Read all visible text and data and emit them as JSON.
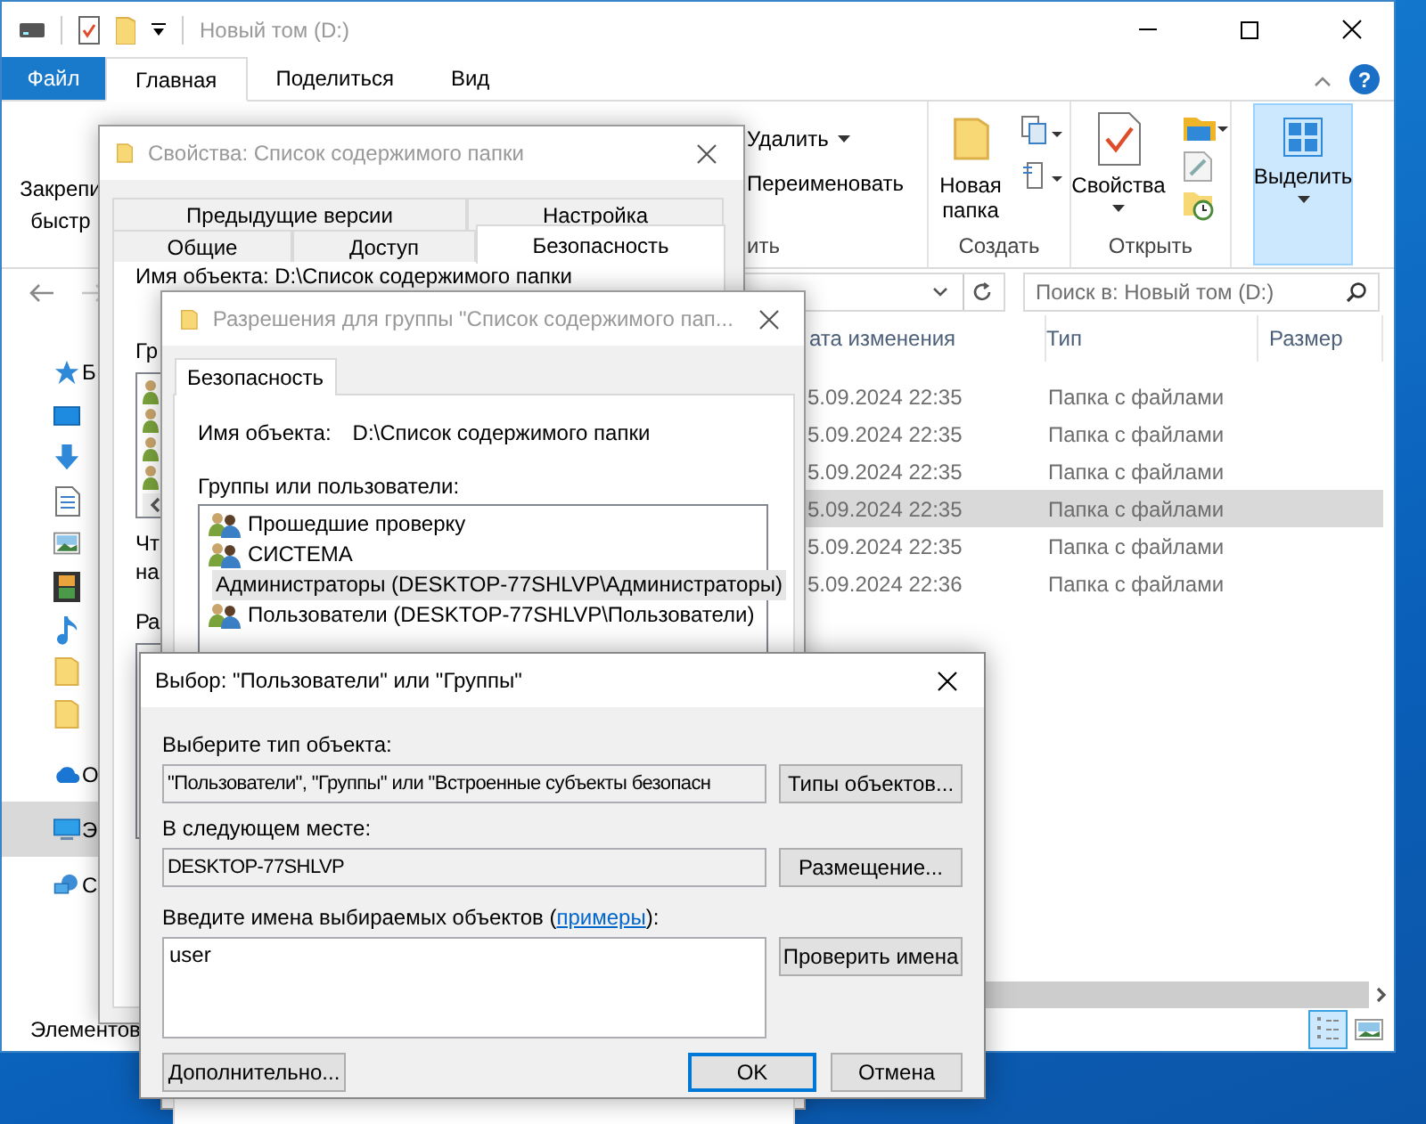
{
  "explorer": {
    "title": "Новый том (D:)",
    "ribbon_tabs": [
      {
        "label": "Файл",
        "kind": "menu",
        "selected": false
      },
      {
        "label": "Главная",
        "kind": "tab",
        "selected": true
      },
      {
        "label": "Поделиться",
        "kind": "tab",
        "selected": false
      },
      {
        "label": "Вид",
        "kind": "tab",
        "selected": false
      }
    ],
    "help": "?",
    "ribbon": {
      "pin_lines": [
        "Закрепи",
        "быстр"
      ],
      "delete": "Удалить",
      "rename": "Переименовать",
      "organize_group": "ить",
      "new_folder": "Новая папка",
      "create_group": "Создать",
      "properties": "Свойства",
      "open_group": "Открыть",
      "select": {
        "label": "Выделить",
        "highlighted": true
      }
    },
    "search": {
      "placeholder": "Поиск в: Новый том (D:)"
    },
    "nav_quick": [
      {
        "label": "Б",
        "selected": false
      },
      {
        "selected": false
      },
      {
        "selected": false
      },
      {
        "selected": false
      },
      {
        "selected": false
      },
      {
        "selected": false
      },
      {
        "selected": false
      },
      {
        "selected": false
      },
      {
        "selected": false
      }
    ],
    "nav_other": [
      {
        "label": "О",
        "selected": false
      },
      {
        "label": "Э",
        "selected": true
      },
      {
        "label": "С",
        "selected": false
      }
    ],
    "columns": [
      "ата изменения",
      "Тип",
      "Размер"
    ],
    "rows": [
      {
        "date": "5.09.2024 22:35",
        "type": "Папка с файлами",
        "selected": false
      },
      {
        "date": "5.09.2024 22:35",
        "type": "Папка с файлами",
        "selected": false
      },
      {
        "date": "5.09.2024 22:35",
        "type": "Папка с файлами",
        "selected": false
      },
      {
        "date": "5.09.2024 22:35",
        "type": "Папка с файлами",
        "selected": true
      },
      {
        "date": "5.09.2024 22:35",
        "type": "Папка с файлами",
        "selected": false
      },
      {
        "date": "5.09.2024 22:36",
        "type": "Папка с файлами",
        "selected": false
      }
    ],
    "status_bar": "Элементов"
  },
  "properties_dialog": {
    "title": "Свойства: Список содержимого папки",
    "tab_rows": [
      [
        {
          "label": "Предыдущие версии",
          "selected": false
        },
        {
          "label": "Настройка",
          "selected": false
        }
      ],
      [
        {
          "label": "Общие",
          "selected": false
        },
        {
          "label": "Доступ",
          "selected": false
        },
        {
          "label": "Безопасность",
          "selected": true
        }
      ]
    ],
    "object_name": "Имя объекта:   D:\\Список содержимого папки",
    "groups_label": "Гр",
    "note_lines": [
      "Чт",
      "на"
    ],
    "permissions_label": "Ра"
  },
  "permissions_dialog": {
    "title": "Разрешения для группы \"Список содержимого пап...",
    "tabs": [
      {
        "label": "Безопасность",
        "selected": true
      }
    ],
    "object_name_label": "Имя объекта:",
    "object_name": "D:\\Список содержимого папки",
    "groups_label": "Группы или пользователи:",
    "principals": [
      {
        "name": "Прошедшие проверку",
        "selected": false
      },
      {
        "name": "СИСТЕМА",
        "selected": false
      },
      {
        "name": "Администраторы (DESKTOP-77SHLVP\\Администраторы)",
        "selected": true
      },
      {
        "name": "Пользователи (DESKTOP-77SHLVP\\Пользователи)",
        "selected": false
      }
    ]
  },
  "select_dialog": {
    "title": "Выбор: \"Пользователи\" или \"Группы\"",
    "object_type_label": "Выберите тип объекта:",
    "object_type": "\"Пользователи\", \"Группы\" или \"Встроенные субъекты безопасн",
    "object_types_button": "Типы объектов...",
    "location_label": "В следующем месте:",
    "location": "DESKTOP-77SHLVP",
    "location_button": "Размещение...",
    "names_label_start": "Введите имена выбираемых объектов (",
    "examples_link": "примеры",
    "names_label_end": "):",
    "names_value": "user",
    "check_names_button": "Проверить имена",
    "advanced_button": "Дополнительно...",
    "ok_button": "OK",
    "cancel_button": "Отмена"
  }
}
